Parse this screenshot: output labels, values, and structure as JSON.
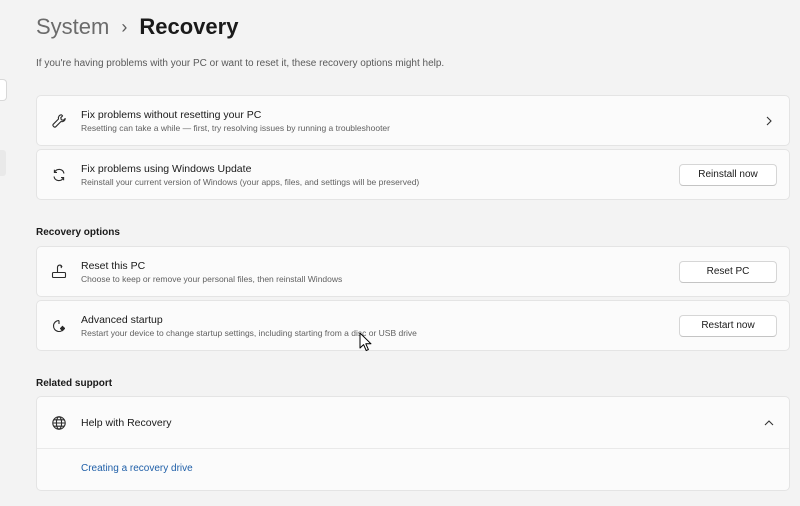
{
  "breadcrumb": {
    "parent": "System",
    "separator": "›",
    "current": "Recovery"
  },
  "subtitle": "If you're having problems with your PC or want to reset it, these recovery options might help.",
  "cards": {
    "fix_without_reset": {
      "icon": "wrench-icon",
      "title": "Fix problems without resetting your PC",
      "description": "Resetting can take a while — first, try resolving issues by running a troubleshooter"
    },
    "fix_windows_update": {
      "icon": "refresh-icon",
      "title": "Fix problems using Windows Update",
      "description": "Reinstall your current version of Windows (your apps, files, and settings will be preserved)",
      "button": "Reinstall now"
    }
  },
  "recovery_options": {
    "header": "Recovery options",
    "reset_pc": {
      "icon": "reset-pc-icon",
      "title": "Reset this PC",
      "description": "Choose to keep or remove your personal files, then reinstall Windows",
      "button": "Reset PC"
    },
    "advanced_startup": {
      "icon": "advanced-startup-icon",
      "title": "Advanced startup",
      "description": "Restart your device to change startup settings, including starting from a disc or USB drive",
      "button": "Restart now"
    }
  },
  "related_support": {
    "header": "Related support",
    "help": {
      "icon": "globe-icon",
      "title": "Help with Recovery",
      "link": "Creating a recovery drive"
    }
  },
  "colors": {
    "background": "#f3f3f3",
    "card": "#fbfbfb",
    "link": "#1f5fa8"
  }
}
